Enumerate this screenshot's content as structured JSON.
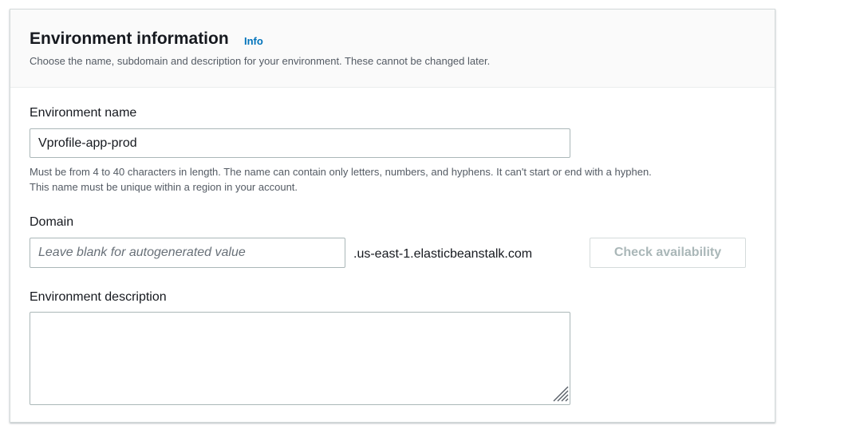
{
  "section": {
    "title": "Environment information",
    "info_link": "Info",
    "description": "Choose the name, subdomain and description for your environment. These cannot be changed later."
  },
  "env_name": {
    "label": "Environment name",
    "value": "Vprofile-app-prod",
    "hint_line1": "Must be from 4 to 40 characters in length. The name can contain only letters, numbers, and hyphens. It can't start or end with a hyphen.",
    "hint_line2": "This name must be unique within a region in your account."
  },
  "domain": {
    "label": "Domain",
    "value": "",
    "placeholder": "Leave blank for autogenerated value",
    "suffix": ".us-east-1.elasticbeanstalk.com",
    "check_button": "Check availability",
    "check_button_state": "disabled"
  },
  "env_description": {
    "label": "Environment description",
    "value": ""
  },
  "colors": {
    "accent_link": "#0073bb",
    "disabled_text": "#aab7b8",
    "header_bg": "#fafafa"
  },
  "icons": {
    "resize_handle": "resize-grip-icon"
  }
}
